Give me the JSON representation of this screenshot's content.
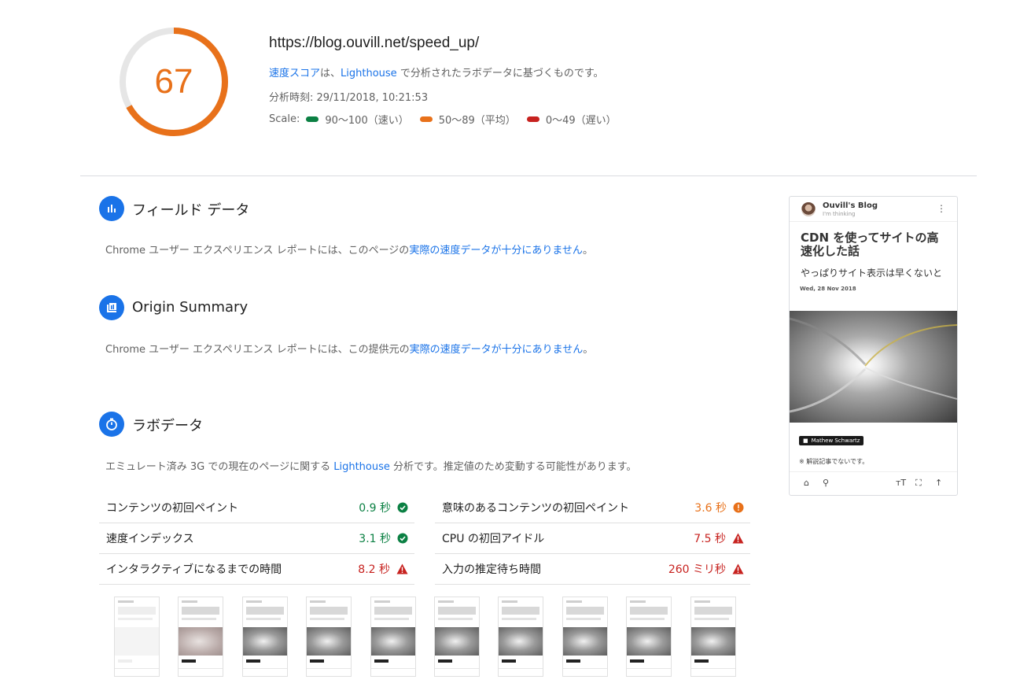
{
  "score": {
    "value": "67",
    "fraction": 0.67,
    "color": "#e8711a"
  },
  "header": {
    "url": "https://blog.ouvill.net/speed_up/",
    "desc_link1": "速度スコア",
    "desc_mid": "は、",
    "desc_link2": "Lighthouse",
    "desc_tail": " で分析されたラボデータに基づくものです。",
    "time": "分析時刻: 29/11/2018, 10:21:53",
    "scale_label": "Scale:",
    "scale": [
      {
        "label": "90〜100（速い）",
        "color": "#0b8043"
      },
      {
        "label": "50〜89（平均）",
        "color": "#e8711a"
      },
      {
        "label": "0〜49（遅い）",
        "color": "#c7221f"
      }
    ]
  },
  "field": {
    "title": "フィールド データ",
    "text_pre": "Chrome ユーザー エクスペリエンス レポートには、このページの",
    "text_link": "実際の速度データが十分にありません",
    "text_post": "。"
  },
  "origin": {
    "title": "Origin Summary",
    "text_pre": "Chrome ユーザー エクスペリエンス レポートには、この提供元の",
    "text_link": "実際の速度データが十分にありません",
    "text_post": "。"
  },
  "lab": {
    "title": "ラボデータ",
    "text_pre": "エミュレート済み 3G での現在のページに関する ",
    "text_link": "Lighthouse",
    "text_post": " 分析です。推定値のため変動する可能性があります。",
    "left": [
      {
        "label": "コンテンツの初回ペイント",
        "value": "0.9 秒",
        "status": "good"
      },
      {
        "label": "速度インデックス",
        "value": "3.1 秒",
        "status": "good"
      },
      {
        "label": "インタラクティブになるまでの時間",
        "value": "8.2 秒",
        "status": "bad"
      }
    ],
    "right": [
      {
        "label": "意味のあるコンテンツの初回ペイント",
        "value": "3.6 秒",
        "status": "avg"
      },
      {
        "label": "CPU の初回アイドル",
        "value": "7.5 秒",
        "status": "bad"
      },
      {
        "label": "入力の推定待ち時間",
        "value": "260 ミリ秒",
        "status": "bad"
      }
    ]
  },
  "preview": {
    "blog_name": "Ouvill's Blog",
    "blog_sub": "I'm thinking",
    "title": "CDN を使ってサイトの高速化した話",
    "lead": "やっぱりサイト表示は早くないと",
    "date": "Wed, 28 Nov 2018",
    "credit": "Mathew Schwartz",
    "note": "※ 解説記事でないです。"
  }
}
